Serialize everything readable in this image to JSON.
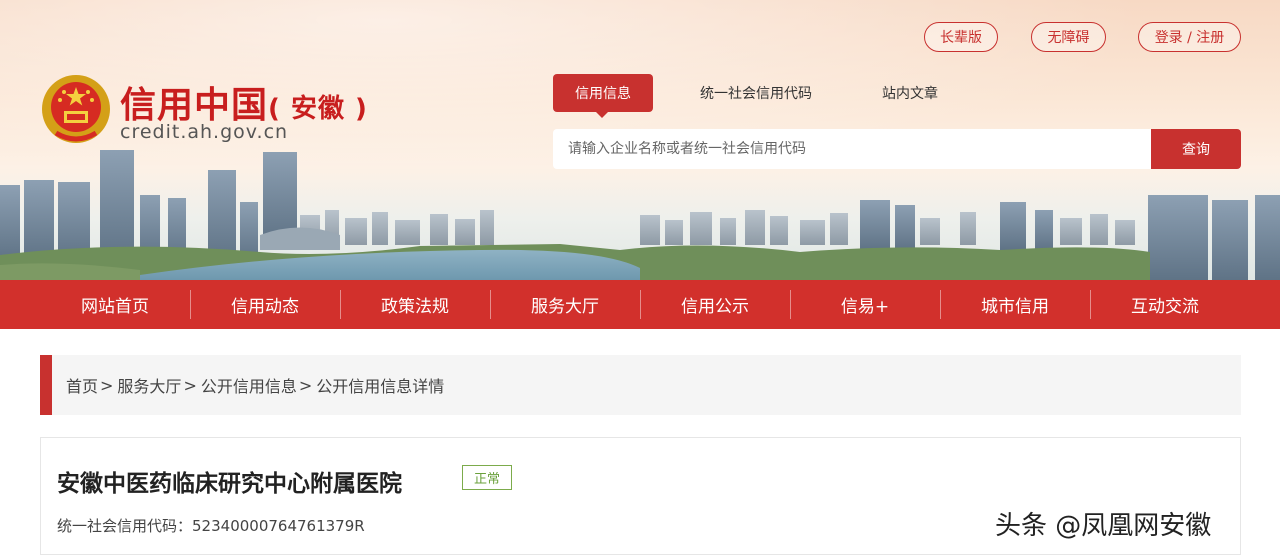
{
  "brand": {
    "name": "信用中国",
    "region": "( 安徽 )",
    "url": "credit.ah.gov.cn"
  },
  "top_buttons": {
    "elder": "长辈版",
    "accessible": "无障碍",
    "login": "登录 / 注册"
  },
  "search": {
    "tabs": [
      "信用信息",
      "统一社会信用代码",
      "站内文章"
    ],
    "active_tab": "信用信息",
    "placeholder": "请输入企业名称或者统一社会信用代码",
    "button": "查询"
  },
  "nav": {
    "items": [
      "网站首页",
      "信用动态",
      "政策法规",
      "服务大厅",
      "信用公示",
      "信易+",
      "城市信用",
      "互动交流"
    ]
  },
  "breadcrumb": {
    "items": [
      "首页",
      "服务大厅",
      "公开信用信息",
      "公开信用信息详情"
    ],
    "separator": ">"
  },
  "detail": {
    "org_name": "安徽中医药临床研究中心附属医院",
    "status": "正常",
    "code_label": "统一社会信用代码：",
    "code_value": "52340000764761379R"
  },
  "watermark": "头条 @凤凰网安徽",
  "colors": {
    "primary_red": "#c8312f",
    "nav_red": "#d2302c",
    "status_green": "#6aa03b"
  }
}
